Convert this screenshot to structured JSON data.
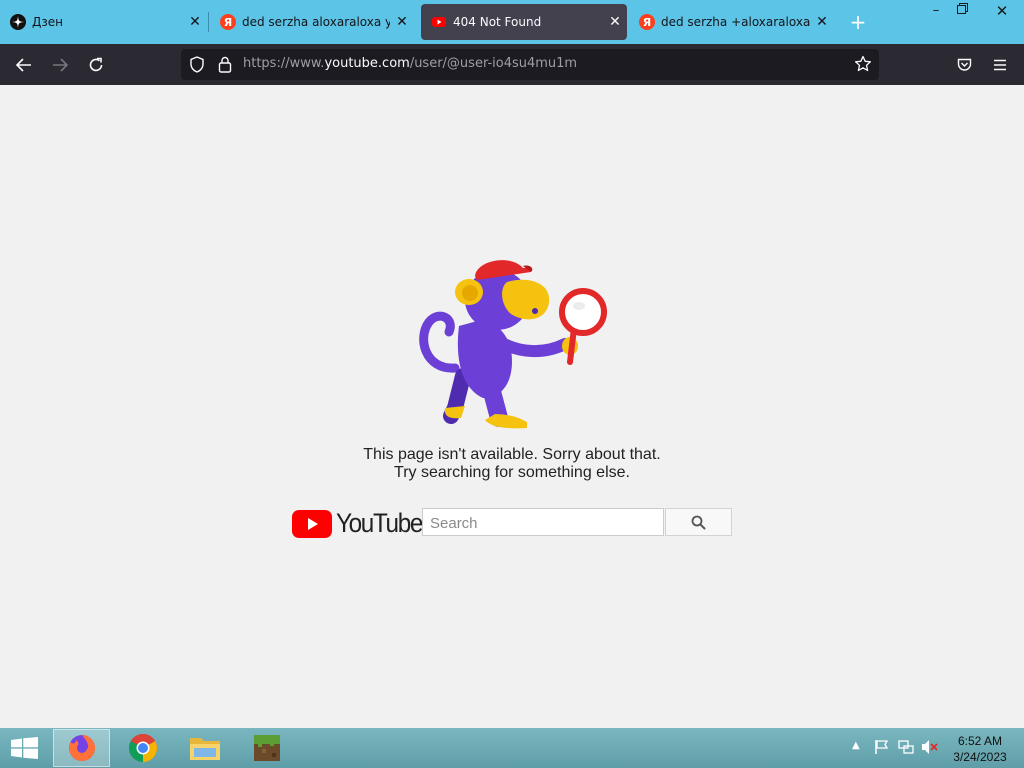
{
  "browser": {
    "tabs": [
      {
        "title": "Дзен",
        "favicon": "dzen-icon",
        "active": false
      },
      {
        "title": "ded serzha aloxaraloxa youtube",
        "favicon": "yandex-icon",
        "active": false
      },
      {
        "title": "404 Not Found",
        "favicon": "youtube-icon",
        "active": true
      },
      {
        "title": "ded serzha +aloxaraloxa youtube",
        "favicon": "yandex-icon",
        "active": false
      }
    ],
    "url": {
      "prefix": "https://www.",
      "domain": "youtube.com",
      "path": "/user/@user-io4su4mu1m"
    }
  },
  "page": {
    "message_line1": "This page isn't available. Sorry about that.",
    "message_line2": "Try searching for something else.",
    "logo_text": "YouTube",
    "search_placeholder": "Search"
  },
  "taskbar": {
    "apps": [
      "firefox",
      "chrome",
      "file-explorer",
      "minecraft"
    ],
    "time": "6:52 AM",
    "date": "3/24/2023"
  },
  "colors": {
    "tab_strip": "#5cc4e6",
    "toolbar": "#2b2a33",
    "youtube_red": "#ff0000",
    "monkey_purple": "#6c3fd6"
  }
}
